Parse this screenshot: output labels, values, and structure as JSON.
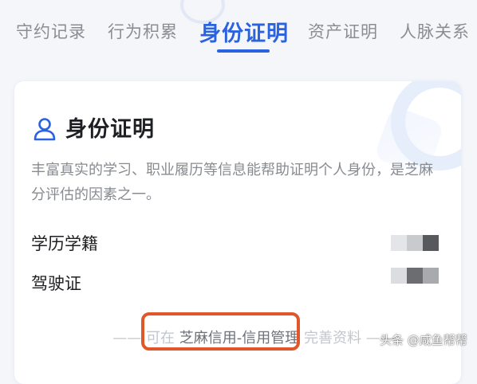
{
  "tabs": [
    {
      "label": "守约记录",
      "active": false
    },
    {
      "label": "行为积累",
      "active": false
    },
    {
      "label": "身份证明",
      "active": true
    },
    {
      "label": "资产证明",
      "active": false
    },
    {
      "label": "人脉关系",
      "active": false
    }
  ],
  "card": {
    "icon": "user-icon",
    "title": "身份证明",
    "description": "丰富真实的学习、职业履历等信息能帮助证明个人身份，是芝麻分评估的因素之一。",
    "items": [
      {
        "label": "学历学籍",
        "value": "blurred"
      },
      {
        "label": "驾驶证",
        "value": "blurred"
      }
    ],
    "footer": {
      "prefix": "—— 可在",
      "link": "芝麻信用-信用管理",
      "suffix": "完善资料 ——"
    }
  },
  "watermark": "头条 @咸鱼帮帮",
  "colors": {
    "accent": "#2a62e0",
    "highlight": "#e0582a"
  }
}
